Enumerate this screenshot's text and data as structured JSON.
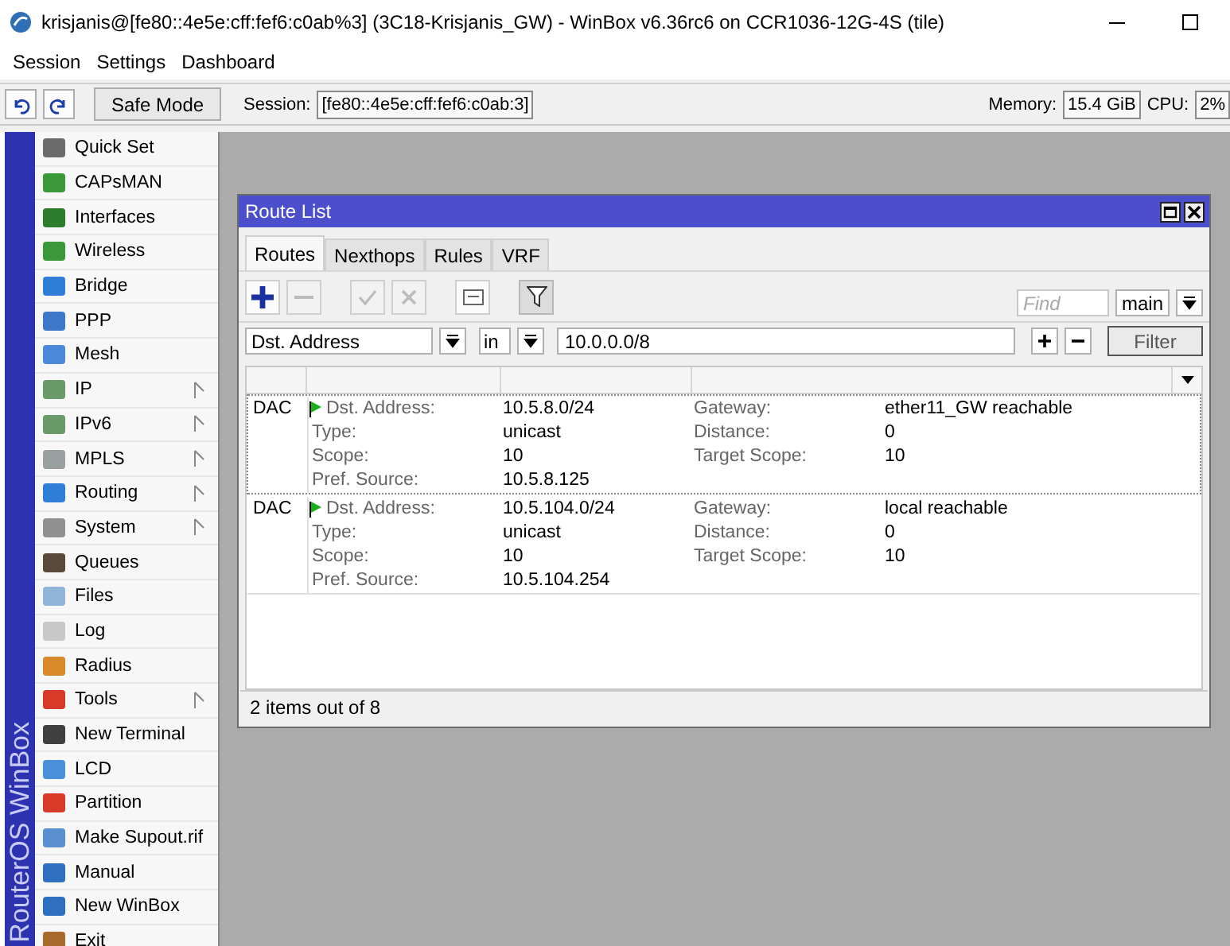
{
  "window": {
    "title": "krisjanis@[fe80::4e5e:cff:fef6:c0ab%3] (3C18-Krisjanis_GW) - WinBox v6.36rc6 on CCR1036-12G-4S (tile)"
  },
  "menu": [
    "Session",
    "Settings",
    "Dashboard"
  ],
  "toolbar": {
    "safe_mode": "Safe Mode",
    "session_label": "Session:",
    "session_value": "[fe80::4e5e:cff:fef6:c0ab:3]",
    "memory_label": "Memory:",
    "memory_value": "15.4 GiB",
    "cpu_label": "CPU:",
    "cpu_value": "2%"
  },
  "sidebar": {
    "brand": "RouterOS WinBox",
    "items": [
      {
        "label": "Quick Set",
        "submenu": false
      },
      {
        "label": "CAPsMAN",
        "submenu": false
      },
      {
        "label": "Interfaces",
        "submenu": false
      },
      {
        "label": "Wireless",
        "submenu": false
      },
      {
        "label": "Bridge",
        "submenu": false
      },
      {
        "label": "PPP",
        "submenu": false
      },
      {
        "label": "Mesh",
        "submenu": false
      },
      {
        "label": "IP",
        "submenu": true
      },
      {
        "label": "IPv6",
        "submenu": true
      },
      {
        "label": "MPLS",
        "submenu": true
      },
      {
        "label": "Routing",
        "submenu": true
      },
      {
        "label": "System",
        "submenu": true
      },
      {
        "label": "Queues",
        "submenu": false
      },
      {
        "label": "Files",
        "submenu": false
      },
      {
        "label": "Log",
        "submenu": false
      },
      {
        "label": "Radius",
        "submenu": false
      },
      {
        "label": "Tools",
        "submenu": true
      },
      {
        "label": "New Terminal",
        "submenu": false
      },
      {
        "label": "LCD",
        "submenu": false
      },
      {
        "label": "Partition",
        "submenu": false
      },
      {
        "label": "Make Supout.rif",
        "submenu": false
      },
      {
        "label": "Manual",
        "submenu": false
      },
      {
        "label": "New WinBox",
        "submenu": false
      },
      {
        "label": "Exit",
        "submenu": false
      }
    ]
  },
  "route_list": {
    "title": "Route List",
    "tabs": [
      {
        "label": "Routes",
        "selected": true
      },
      {
        "label": "Nexthops",
        "selected": false
      },
      {
        "label": "Rules",
        "selected": false
      },
      {
        "label": "VRF",
        "selected": false
      }
    ],
    "tools": [
      {
        "kind": "add",
        "disabled": false,
        "pressed": false
      },
      {
        "kind": "remove",
        "disabled": true,
        "pressed": false
      },
      {
        "kind": "enable",
        "disabled": true,
        "pressed": false
      },
      {
        "kind": "disable",
        "disabled": true,
        "pressed": false
      },
      {
        "kind": "comment",
        "disabled": false,
        "pressed": false
      },
      {
        "kind": "filter",
        "disabled": false,
        "pressed": true
      }
    ],
    "find": {
      "placeholder": "Find"
    },
    "table": "main",
    "filter": {
      "field": "Dst. Address",
      "operator": "in",
      "value": "10.0.0.0/8",
      "button": "Filter"
    },
    "routes": [
      {
        "flags": "DAC",
        "selected": true,
        "active": true,
        "details": [
          {
            "label": "Dst. Address:",
            "value": "10.5.8.0/24"
          },
          {
            "label": "Type:",
            "value": "unicast"
          },
          {
            "label": "Scope:",
            "value": "10"
          },
          {
            "label": "Pref. Source:",
            "value": "10.5.8.125"
          }
        ],
        "details_right": [
          {
            "label": "Gateway:",
            "value": "ether11_GW reachable"
          },
          {
            "label": "Distance:",
            "value": "0"
          },
          {
            "label": "Target Scope:",
            "value": "10"
          }
        ]
      },
      {
        "flags": "DAC",
        "selected": false,
        "active": true,
        "details": [
          {
            "label": "Dst. Address:",
            "value": "10.5.104.0/24"
          },
          {
            "label": "Type:",
            "value": "unicast"
          },
          {
            "label": "Scope:",
            "value": "10"
          },
          {
            "label": "Pref. Source:",
            "value": "10.5.104.254"
          }
        ],
        "details_right": [
          {
            "label": "Gateway:",
            "value": "local reachable"
          },
          {
            "label": "Distance:",
            "value": "0"
          },
          {
            "label": "Target Scope:",
            "value": "10"
          }
        ]
      }
    ],
    "status": "2 items out of 8"
  }
}
